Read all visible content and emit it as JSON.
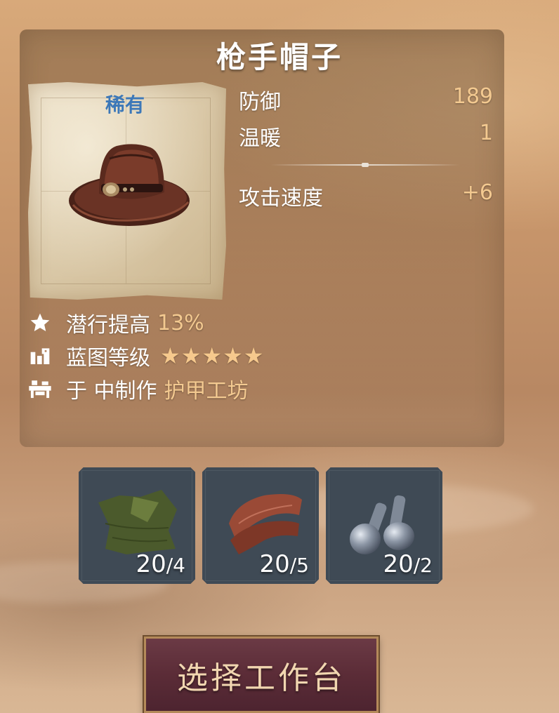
{
  "item": {
    "title": "枪手帽子",
    "rarity": "稀有",
    "rarity_color": "#3d78b8",
    "image": "leather-cowboy-hat"
  },
  "stats": [
    {
      "label": "防御",
      "value": "189"
    },
    {
      "label": "温暖",
      "value": "1"
    }
  ],
  "bonus_stats": [
    {
      "label": "攻击速度",
      "value": "+6"
    }
  ],
  "info": {
    "perk_label": "潜行提高",
    "perk_value": "13%",
    "blueprint_label": "蓝图等级",
    "blueprint_stars": 5,
    "craft_label": "于 中制作",
    "craft_station": "护甲工坊"
  },
  "materials": [
    {
      "icon": "cloth-icon",
      "have": "20",
      "need": "/4"
    },
    {
      "icon": "leather-icon",
      "have": "20",
      "need": "/5"
    },
    {
      "icon": "rivets-icon",
      "have": "20",
      "need": "/2"
    }
  ],
  "action": {
    "label": "选择工作台"
  },
  "colors": {
    "accent": "#f3c990",
    "button_bg": "#5b2c37",
    "material_tile": "#3f4a55"
  }
}
